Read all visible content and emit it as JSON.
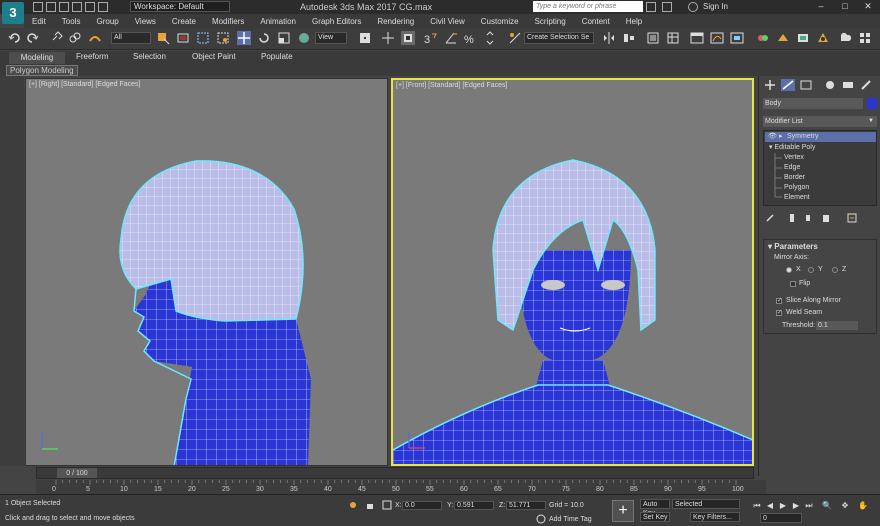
{
  "titlebar": {
    "logo": "3",
    "workspace": "Workspace: Default",
    "title": "Autodesk 3ds Max 2017    CG.max",
    "search_placeholder": "Type a keyword or phrase",
    "sign_in": "Sign In",
    "minimize": "–",
    "maximize": "□",
    "close": "✕"
  },
  "menu": [
    "Edit",
    "Tools",
    "Group",
    "Views",
    "Create",
    "Modifiers",
    "Animation",
    "Graph Editors",
    "Rendering",
    "Civil View",
    "Customize",
    "Scripting",
    "Content",
    "Help"
  ],
  "toolbar": {
    "filter": "All",
    "refcoord": "View",
    "selection_set": "Create Selection Se"
  },
  "ribbon": {
    "tabs": [
      "Modeling",
      "Freeform",
      "Selection",
      "Object Paint",
      "Populate"
    ],
    "active_tab": "Modeling",
    "panel": "Polygon Modeling"
  },
  "viewports": {
    "left_label": "[+] [Right] [Standard] [Edged Faces]",
    "right_label": "[+] [Front] [Standard] [Edged Faces]"
  },
  "command_panel": {
    "object_name": "Body",
    "object_color": "#2a35d6",
    "modifier_list": "Modifier List",
    "stack": [
      {
        "label": "Symmetry",
        "selected": true
      },
      {
        "label": "Editable Poly",
        "selected": false
      },
      {
        "label": "Vertex",
        "selected": false
      },
      {
        "label": "Edge",
        "selected": false
      },
      {
        "label": "Border",
        "selected": false
      },
      {
        "label": "Polygon",
        "selected": false
      },
      {
        "label": "Element",
        "selected": false
      }
    ],
    "params": {
      "title": "Parameters",
      "mirror_axis": "Mirror Axis:",
      "axes": [
        "X",
        "Y",
        "Z"
      ],
      "selected_axis": "X",
      "flip": "Flip",
      "slice": "Slice Along Mirror",
      "weld": "Weld Seam",
      "threshold_label": "Threshold:",
      "threshold_value": "0.1"
    }
  },
  "timeline": {
    "slider": "0 / 100",
    "ticks": [
      "0",
      "5",
      "10",
      "15",
      "20",
      "25",
      "30",
      "35",
      "40",
      "45",
      "50",
      "55",
      "60",
      "65",
      "70",
      "75",
      "80",
      "85",
      "90",
      "95",
      "100"
    ]
  },
  "status": {
    "selected": "1 Object Selected",
    "prompt": "Click and drag to select and move objects",
    "x_label": "X:",
    "x": "0.0",
    "y_label": "Y:",
    "y": "0.591",
    "z_label": "Z:",
    "z": "51.771",
    "grid": "Grid = 10.0",
    "add_time_tag": "Add Time Tag",
    "auto_key": "Auto Key",
    "set_key": "Set Key",
    "key_mode": "Selected",
    "key_filters": "Key Filters...",
    "frame": "0"
  },
  "colors": {
    "mesh": "#2a35d6",
    "hair": "#b9bde8",
    "active_border": "#e8e34b",
    "outline": "#6fe8ff"
  }
}
